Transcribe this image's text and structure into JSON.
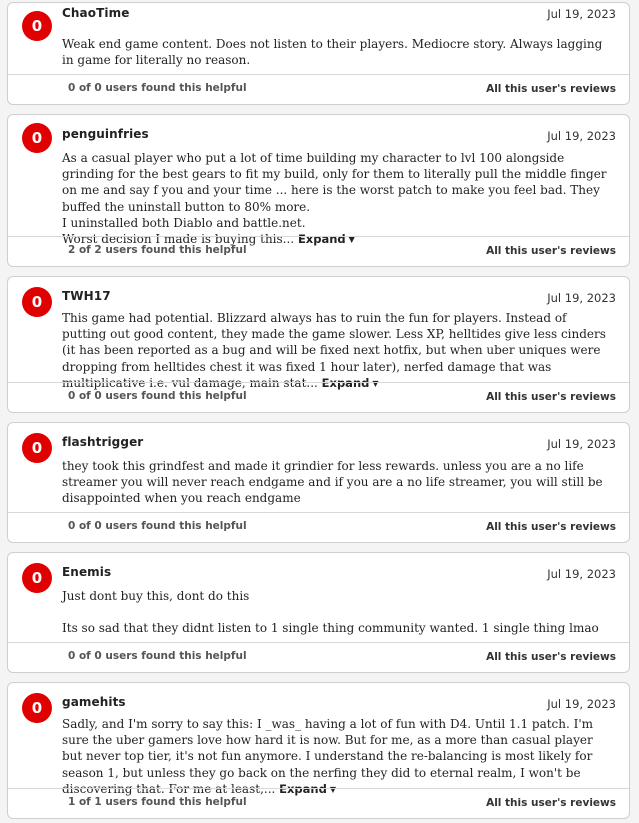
{
  "footer_link": "All this user's reviews",
  "expand_label": "Expand",
  "reviews": [
    {
      "score": "0",
      "author": "ChaoTime",
      "date": "Jul 19, 2023",
      "text": "Weak end game content. Does not listen to their players. Mediocre story. Always lagging in game for literally no reason.",
      "helpful": "0 of 0 users found this helpful"
    },
    {
      "score": "0",
      "author": "penguinfries",
      "date": "Jul 19, 2023",
      "text": "As a casual player who put a lot of time building my character to lvl 100 alongside grinding for the best gears to fit my build, only for them to literally pull the middle finger on me and say f you and your time ... here is the worst patch to make you feel bad. They buffed the uninstall button to 80% more.\nI uninstalled both Diablo and battle.net.\nWorst decision I made is buying this...",
      "helpful": "2 of 2 users found this helpful"
    },
    {
      "score": "0",
      "author": "TWH17",
      "date": "Jul 19, 2023",
      "text": "This game had potential. Blizzard always has to ruin the fun for players. Instead of putting out good content, they made the game slower. Less XP, helltides give less cinders (it has been reported as a bug and will be fixed next hotfix, but when uber uniques were dropping from helltides chest it was fixed 1 hour later), nerfed damage that was multiplicative i.e. vul damage, main stat...",
      "helpful": "0 of 0 users found this helpful"
    },
    {
      "score": "0",
      "author": "flashtrigger",
      "date": "Jul 19, 2023",
      "text": "they took this grindfest and made it grindier for less rewards. unless you are a no life streamer you will never reach endgame and if you are a no life streamer, you will still be disappointed when you reach endgame",
      "helpful": "0 of 0 users found this helpful"
    },
    {
      "score": "0",
      "author": "Enemis",
      "date": "Jul 19, 2023",
      "text": "Just dont buy this, dont do this\n\nIts so sad that they didnt listen to 1 single thing community wanted. 1 single thing lmao",
      "helpful": "0 of 0 users found this helpful"
    },
    {
      "score": "0",
      "author": "gamehits",
      "date": "Jul 19, 2023",
      "text": "Sadly, and I'm sorry to say this: I _was_ having a lot of fun with D4. Until 1.1 patch. I'm sure the uber gamers love how hard it is now. But for me, as a more than casual player but never top tier, it's not fun anymore. I understand the re-balancing is most likely for season 1, but unless they go back on the nerfing they did to eternal realm, I won't be discovering that. For me at least,...",
      "helpful": "1 of 1 users found this helpful"
    }
  ]
}
